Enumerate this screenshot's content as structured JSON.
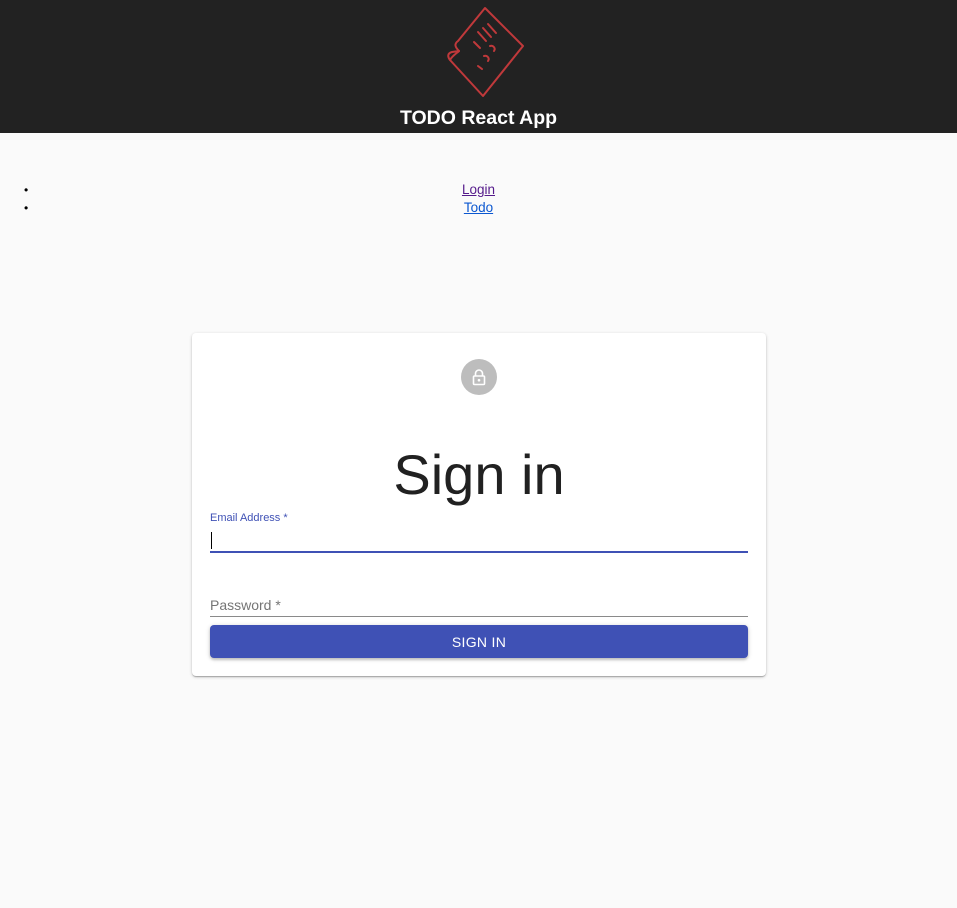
{
  "header": {
    "title": "TODO React App",
    "logo_icon": "todo-document-icon",
    "background": "#222222",
    "logo_color": "#c0393b"
  },
  "nav": {
    "items": [
      {
        "label": "Login"
      },
      {
        "label": "Todo"
      }
    ]
  },
  "signin": {
    "avatar_icon": "lock-icon",
    "title": "Sign in",
    "email_label": "Email Address *",
    "email_value": "",
    "password_placeholder": "Password *",
    "button_label": "SIGN IN",
    "accent": "#3f51b5"
  }
}
